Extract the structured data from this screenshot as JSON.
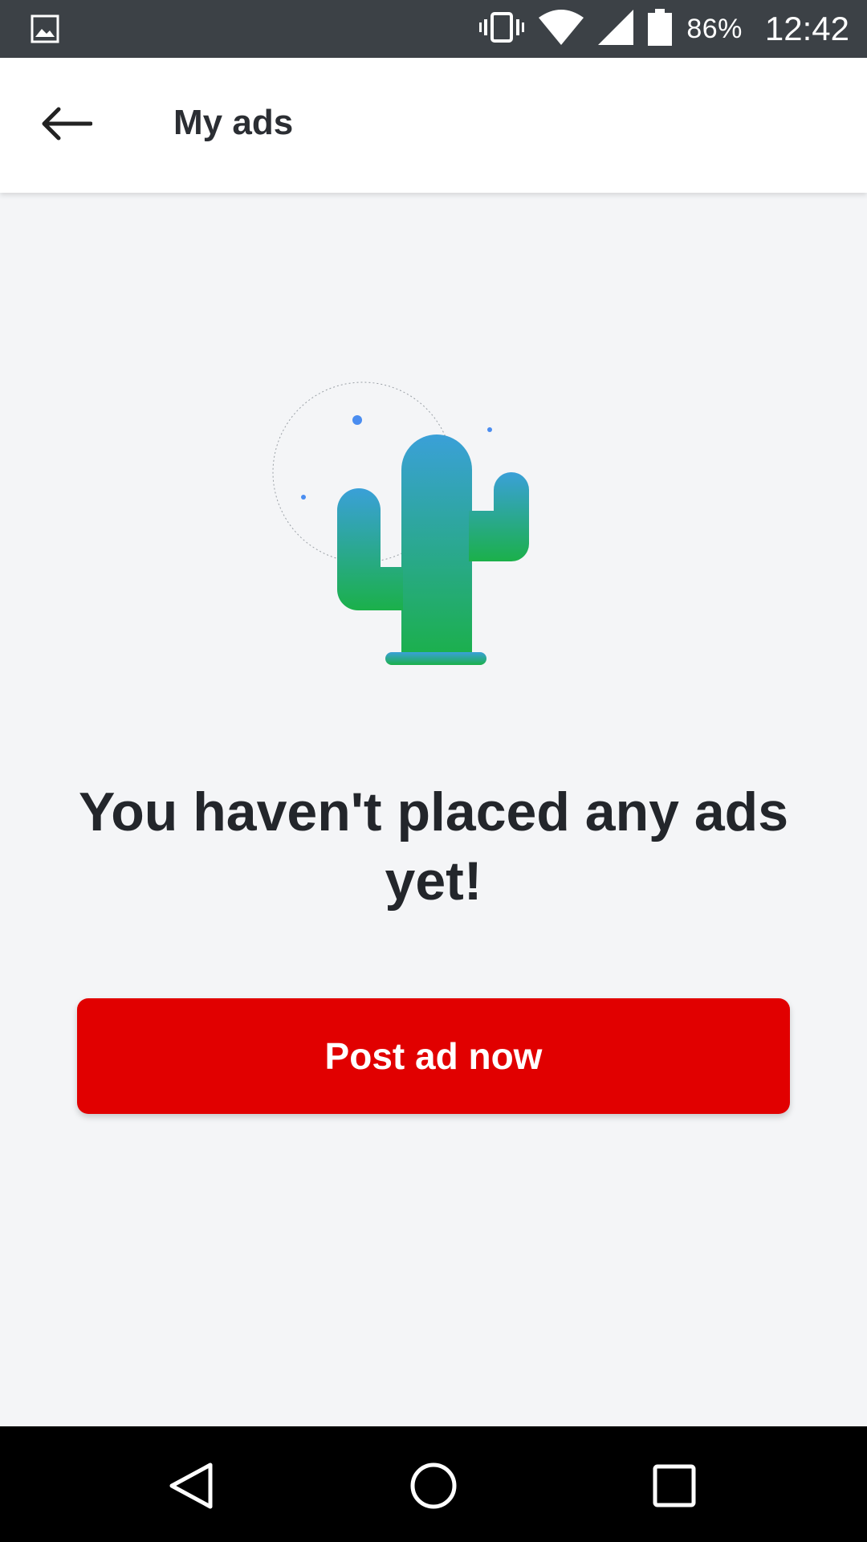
{
  "status_bar": {
    "battery_percent": "86%",
    "time": "12:42",
    "icons": [
      "gallery-icon",
      "vibrate-icon",
      "wifi-icon",
      "signal-icon",
      "battery-icon"
    ]
  },
  "app_bar": {
    "title": "My ads",
    "back_icon": "back-arrow-icon"
  },
  "empty_state": {
    "illustration": "cactus-illustration",
    "message": "You haven't placed any ads yet!",
    "cta_label": "Post ad now"
  },
  "colors": {
    "cta": "#e10000",
    "background": "#f4f5f7",
    "status_bar": "#3c4146",
    "cactus_top": "#3aa0d8",
    "cactus_bottom": "#1bb04a"
  },
  "nav_bar": {
    "icons": [
      "nav-back-icon",
      "nav-home-icon",
      "nav-recents-icon"
    ]
  }
}
